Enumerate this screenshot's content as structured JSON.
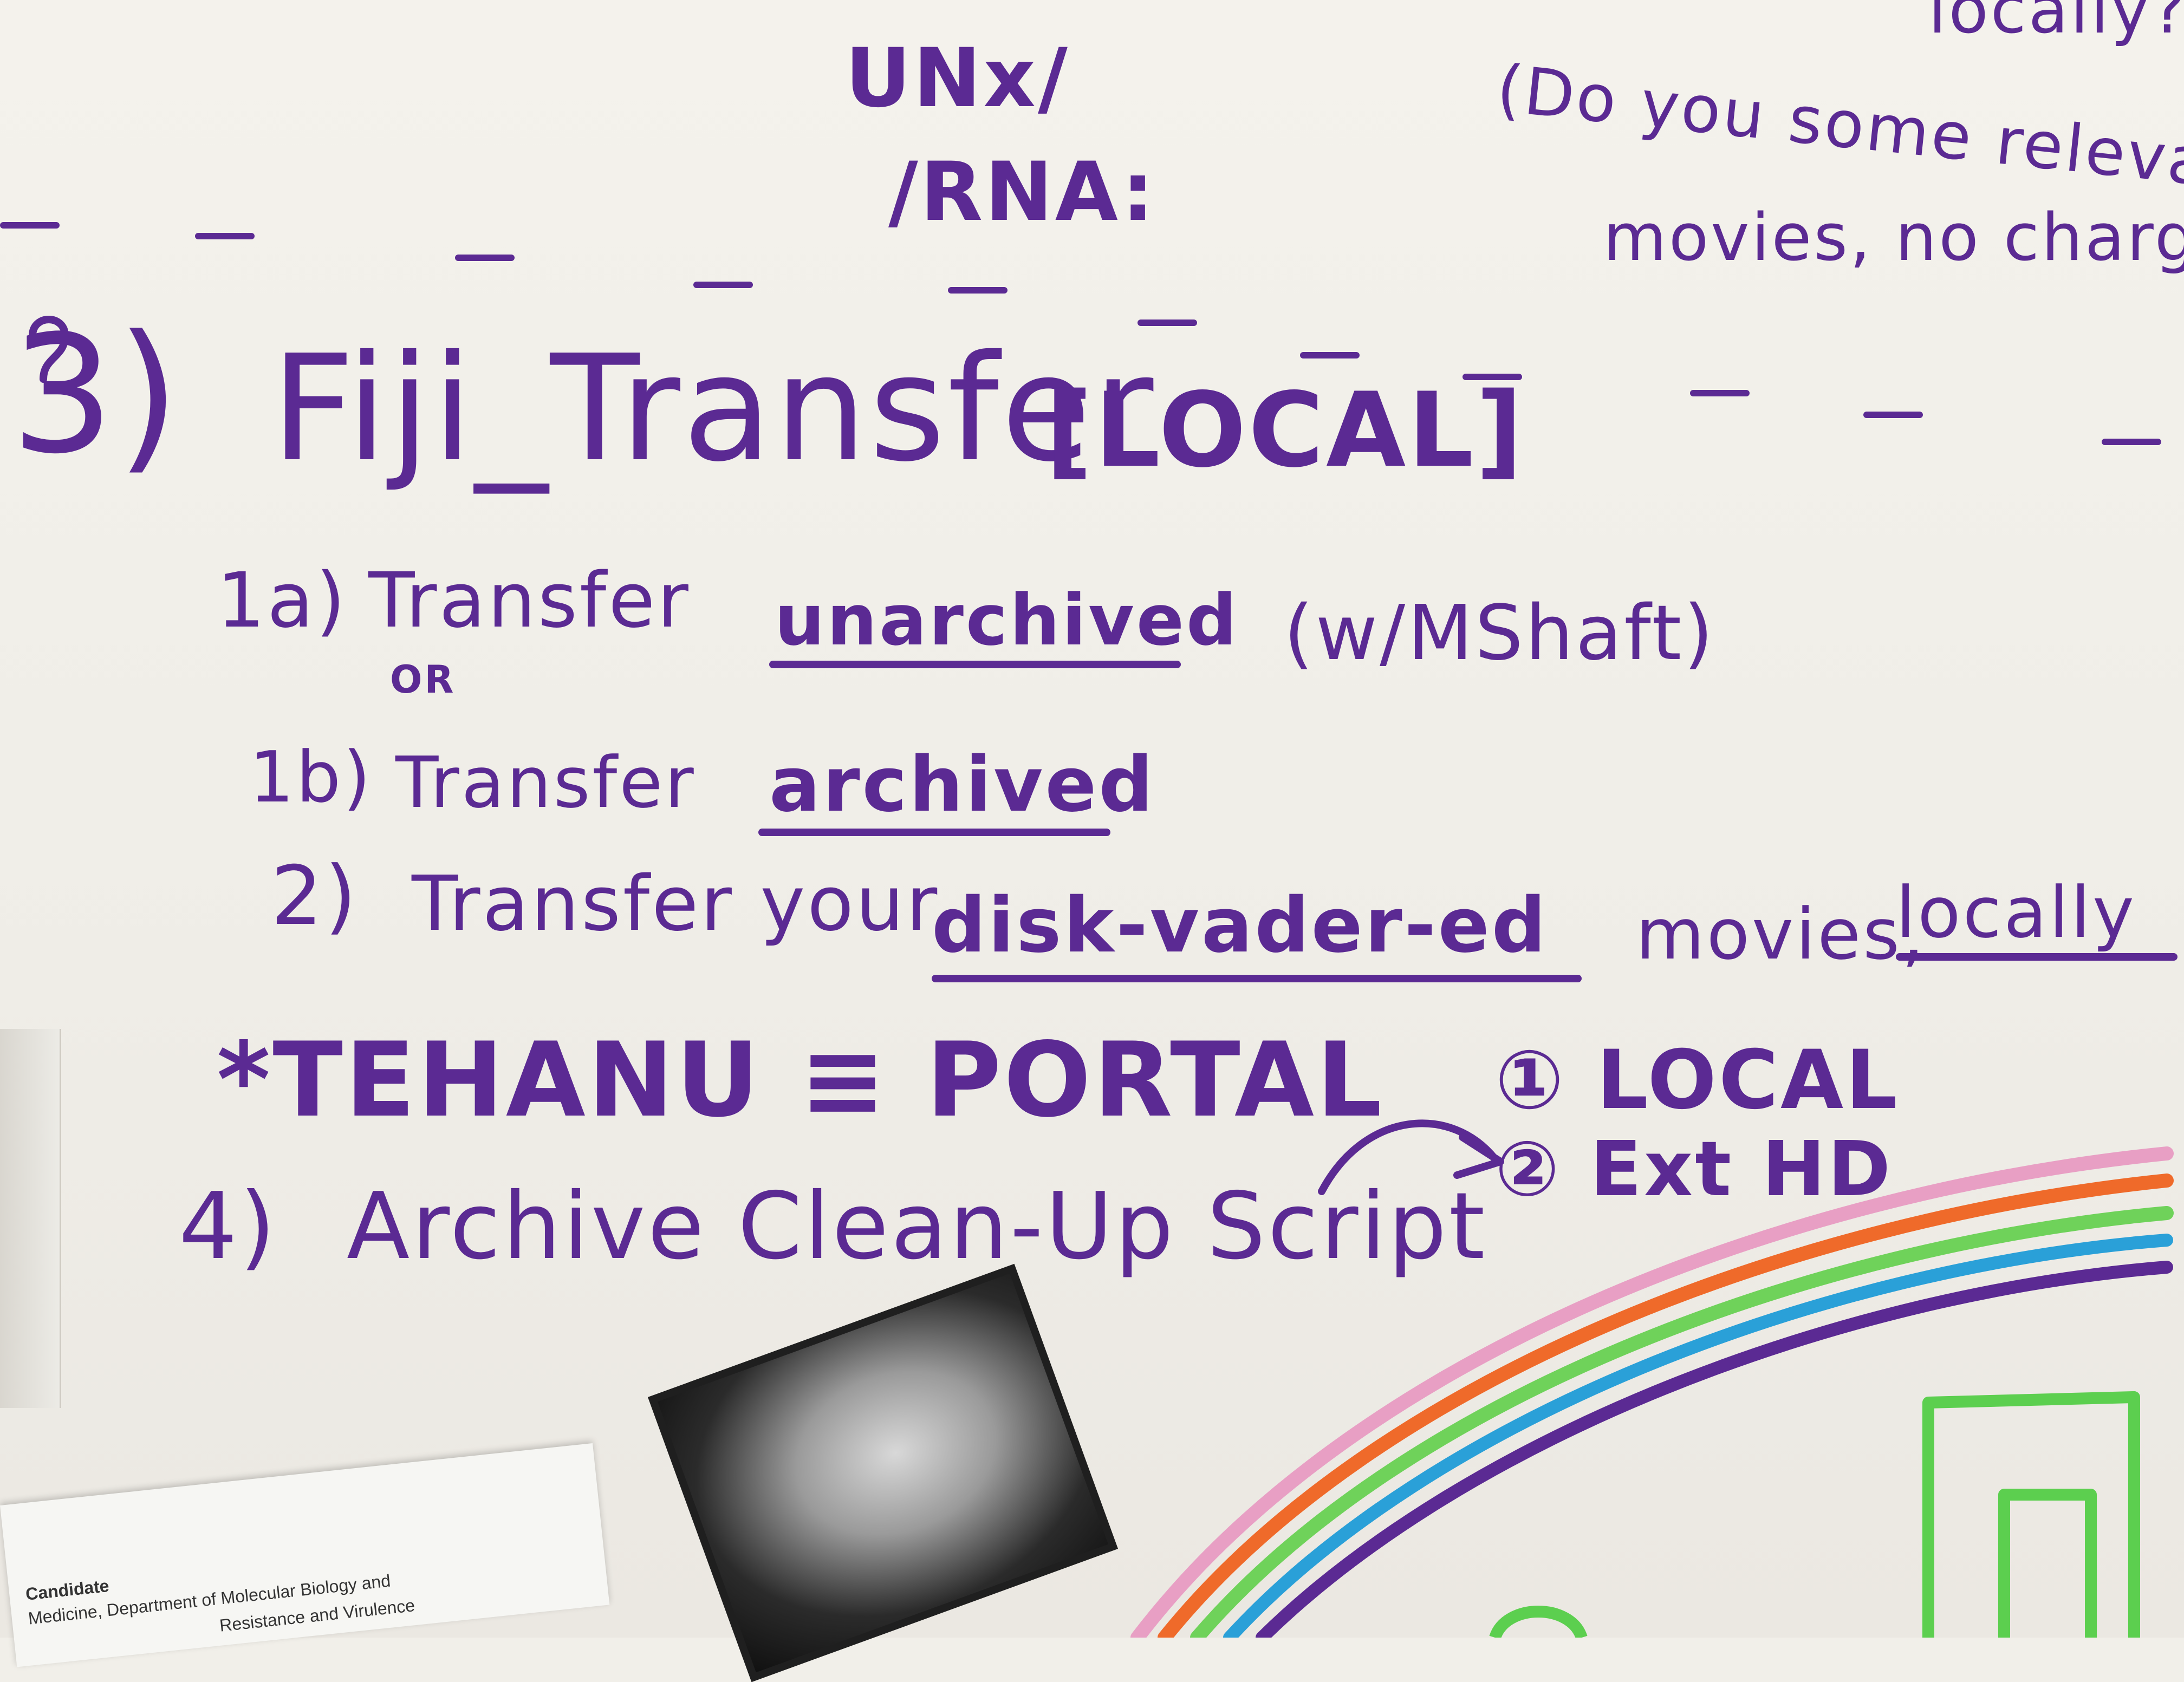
{
  "board": {
    "top_fragments": {
      "unx": "UNx/",
      "rna": "/RNA:",
      "question": "(Do you some relevant",
      "movies_line": "movies, no charge",
      "locally_q": "locally?"
    },
    "section3": {
      "number": "3)",
      "title": "Fiji_Transfer",
      "bracket_tag": "[LOCAL]"
    },
    "steps": [
      {
        "label": "1a)",
        "verb": "Transfer",
        "emph": "unarchived",
        "note": "(w/MShaft)"
      },
      {
        "connector": "OR"
      },
      {
        "label": "1b)",
        "verb": "Transfer",
        "emph": "archived"
      },
      {
        "label": "2)",
        "verb": "Transfer your",
        "emph": "disk-vader-ed",
        "tail": "movies,",
        "tail_emph": "locally"
      }
    ],
    "tehanu": "*TEHANU ≡ PORTAL",
    "options": [
      "① LOCAL",
      "② Ext HD"
    ],
    "step4": {
      "label": "4)",
      "text": "Archive Clean-Up Script"
    }
  },
  "paper": {
    "line1": "Candidate",
    "line2": "Medicine, Department of Molecular Biology and",
    "line3": "Resistance and Virulence"
  },
  "colors": {
    "ink": "#5b2a93",
    "rainbow": [
      "#e89fc4",
      "#ef6a2a",
      "#6fd25a",
      "#2aa0d8",
      "#5b2a93"
    ],
    "green_drawing": "#5ccf4f"
  },
  "icons": {
    "arrow": "curved-arrow-icon",
    "magnet": "photo-magnet-icon"
  }
}
